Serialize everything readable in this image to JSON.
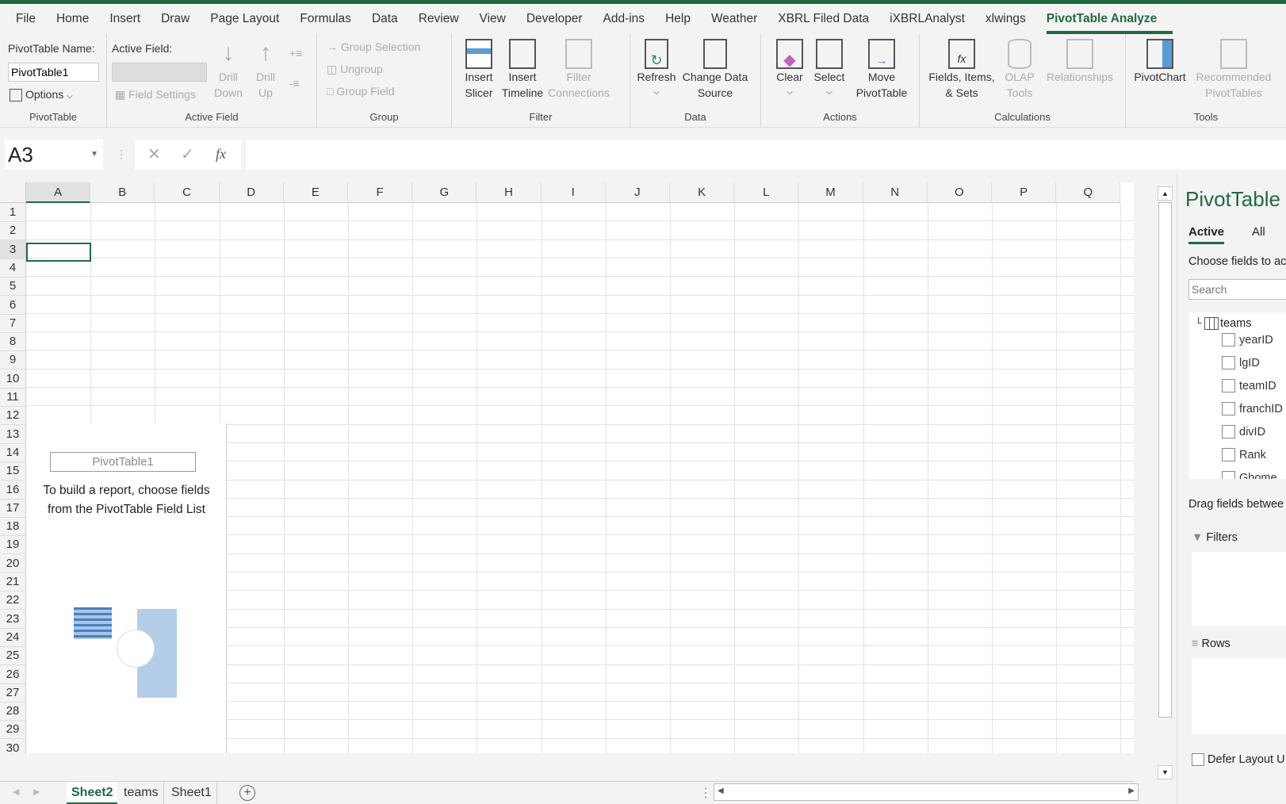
{
  "ribbon_tabs": [
    "File",
    "Home",
    "Insert",
    "Draw",
    "Page Layout",
    "Formulas",
    "Data",
    "Review",
    "View",
    "Developer",
    "Add-ins",
    "Help",
    "Weather",
    "XBRL Filed Data",
    "iXBRLAnalyst",
    "xlwings",
    "PivotTable Analyze"
  ],
  "ribbon": {
    "pivottable": {
      "name_label": "PivotTable Name:",
      "name_value": "PivotTable1",
      "options": "Options",
      "group": "PivotTable"
    },
    "active_field": {
      "label": "Active Field:",
      "field_settings": "Field Settings",
      "drill_down": [
        "Drill",
        "Down"
      ],
      "drill_up": [
        "Drill",
        "Up"
      ],
      "group": "Active Field"
    },
    "group": {
      "group_selection": "Group Selection",
      "ungroup": "Ungroup",
      "group_field": "Group Field",
      "group": "Group"
    },
    "filter": {
      "insert_slicer": [
        "Insert",
        "Slicer"
      ],
      "insert_timeline": [
        "Insert",
        "Timeline"
      ],
      "filter_connections": [
        "Filter",
        "Connections"
      ],
      "group": "Filter"
    },
    "data": {
      "refresh": "Refresh",
      "change_data_source": [
        "Change Data",
        "Source"
      ],
      "group": "Data"
    },
    "actions": {
      "clear": "Clear",
      "select": "Select",
      "move": [
        "Move",
        "PivotTable"
      ],
      "group": "Actions"
    },
    "calculations": {
      "fields": [
        "Fields, Items,",
        "& Sets"
      ],
      "olap": [
        "OLAP",
        "Tools"
      ],
      "relationships": "Relationships",
      "group": "Calculations"
    },
    "tools": {
      "pivotchart": "PivotChart",
      "recommended": [
        "Recommended",
        "PivotTables"
      ],
      "group": "Tools"
    }
  },
  "formula_bar": {
    "name_box": "A3",
    "fx": "fx",
    "value": ""
  },
  "columns": [
    "A",
    "B",
    "C",
    "D",
    "E",
    "F",
    "G",
    "H",
    "I",
    "J",
    "K",
    "L",
    "M",
    "N",
    "O",
    "P",
    "Q"
  ],
  "rows": [
    "1",
    "2",
    "3",
    "4",
    "5",
    "6",
    "7",
    "8",
    "9",
    "10",
    "11",
    "12",
    "13",
    "14",
    "15",
    "16",
    "17",
    "18",
    "19",
    "20",
    "21",
    "22",
    "23",
    "24",
    "25",
    "26",
    "27",
    "28",
    "29",
    "30"
  ],
  "pivot_placeholder": {
    "title": "PivotTable1",
    "line1": "To build a report, choose fields",
    "line2": "from the PivotTable Field List"
  },
  "sheets": [
    {
      "name": "Sheet2",
      "active": true
    },
    {
      "name": "teams"
    },
    {
      "name": "Sheet1"
    }
  ],
  "field_list": {
    "title": "PivotTable",
    "tab_active": "Active",
    "tab_all": "All",
    "choose": "Choose fields to ac",
    "search_placeholder": "Search",
    "table": "teams",
    "fields": [
      "yearID",
      "lgID",
      "teamID",
      "franchID",
      "divID",
      "Rank",
      "Ghome"
    ],
    "drag": "Drag fields betwee",
    "filters": "Filters",
    "rows": "Rows",
    "defer": "Defer Layout U"
  }
}
